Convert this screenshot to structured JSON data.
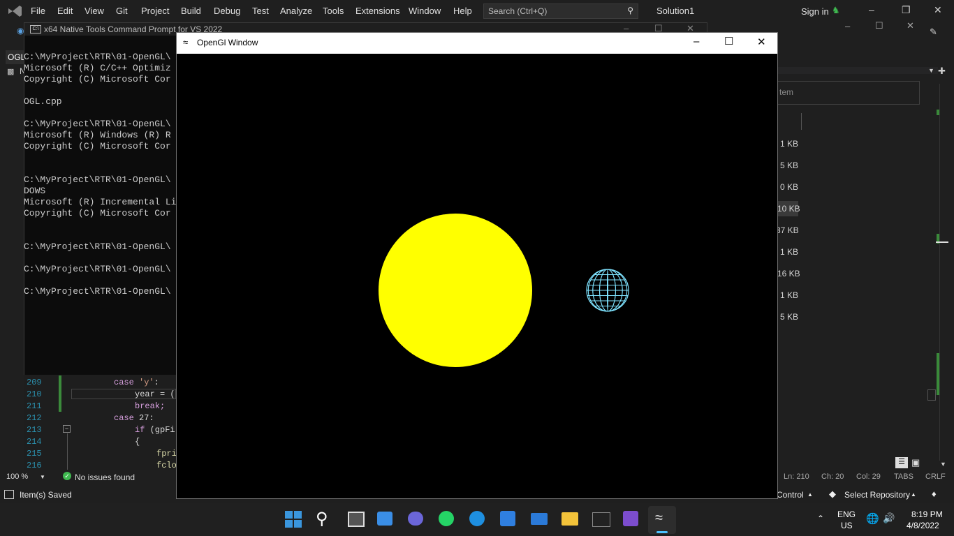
{
  "vs": {
    "menu": [
      "File",
      "Edit",
      "View",
      "Git",
      "Project",
      "Build",
      "Debug",
      "Test",
      "Analyze",
      "Tools",
      "Extensions",
      "Window",
      "Help"
    ],
    "search_placeholder": "Search (Ctrl+Q)",
    "solution_name": "Solution1",
    "signin": "Sign in",
    "tab_label": "OGL",
    "tab_label2": "N"
  },
  "console": {
    "title": "x64 Native Tools Command Prompt for VS 2022",
    "lines": [
      "C:\\MyProject\\RTR\\01-OpenGL\\",
      "Microsoft (R) C/C++ Optimiz",
      "Copyright (C) Microsoft Cor",
      "",
      "OGL.cpp",
      "",
      "C:\\MyProject\\RTR\\01-OpenGL\\",
      "Microsoft (R) Windows (R) R",
      "Copyright (C) Microsoft Cor",
      "",
      "",
      "C:\\MyProject\\RTR\\01-OpenGL\\",
      "DOWS",
      "Microsoft (R) Incremental Li",
      "Copyright (C) Microsoft Cor",
      "",
      "",
      "C:\\MyProject\\RTR\\01-OpenGL\\",
      "",
      "C:\\MyProject\\RTR\\01-OpenGL\\",
      "",
      "C:\\MyProject\\RTR\\01-OpenGL\\"
    ]
  },
  "editor": {
    "line_numbers": [
      "209",
      "210",
      "211",
      "212",
      "213",
      "214",
      "215",
      "216"
    ],
    "code": {
      "l209_kw": "case",
      "l209_str": "'y'",
      "l209_rest": ":",
      "l210": "year = (",
      "l211": "break;",
      "l212_kw": "case",
      "l212_rest": " 27:",
      "l213_kw": "if",
      "l213_rest": " (gpFi",
      "l214": "{",
      "l215": "fpri",
      "l216": "fclo"
    },
    "zoom": "100 %",
    "issues": "No issues found"
  },
  "status": {
    "ln": "Ln: 210",
    "ch": "Ch: 20",
    "col": "Col: 29",
    "tabs": "TABS",
    "crlf": "CRLF",
    "saved": "Item(s) Saved",
    "control": "Control",
    "select_repo": "Select Repository"
  },
  "solution_panel": {
    "search_placeholder": "tem",
    "sizes": [
      "1 KB",
      "5 KB",
      "0 KB",
      "10 KB",
      "37 KB",
      "1 KB",
      "16 KB",
      "1 KB",
      "5 KB"
    ]
  },
  "gl_window": {
    "title": "OpenGl Window",
    "sun_color": "#ffff00",
    "planet_color": "#7fe3ff",
    "background": "#000000"
  },
  "taskbar": {
    "lang": "ENG",
    "region": "US",
    "time": "8:19 PM",
    "date": "4/8/2022",
    "apps": [
      "start-icon",
      "search-icon",
      "task-view-icon",
      "widgets-icon",
      "teams-chat-icon",
      "whatsapp-icon",
      "edge-icon",
      "store-icon",
      "mail-icon",
      "file-explorer-icon",
      "terminal-icon",
      "visual-studio-icon",
      "opengl-app-icon"
    ]
  }
}
